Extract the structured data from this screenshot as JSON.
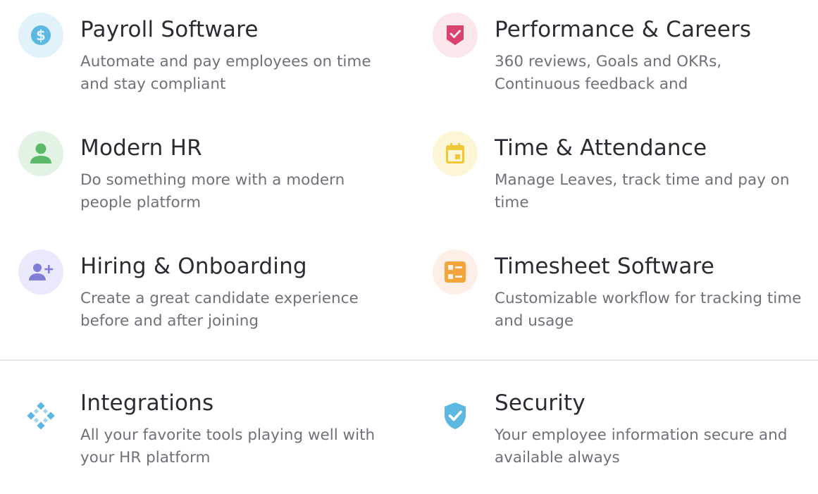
{
  "features": [
    {
      "title": "Payroll Software",
      "description": "Automate and pay employees on time and stay compliant",
      "icon": "dollar-icon",
      "icon_bg": "#e1f2fa",
      "icon_color": "#5cb8e0"
    },
    {
      "title": "Performance & Careers",
      "description": "360 reviews, Goals and OKRs, Continuous feedback and",
      "icon": "badge-check-icon",
      "icon_bg": "#fbe6ec",
      "icon_color": "#d9436d"
    },
    {
      "title": "Modern HR",
      "description": "Do something more with a modern people platform",
      "icon": "person-icon",
      "icon_bg": "#e2f2e4",
      "icon_color": "#5aba6a"
    },
    {
      "title": "Time & Attendance",
      "description": "Manage Leaves, track time and pay on time",
      "icon": "calendar-icon",
      "icon_bg": "#fdf6d6",
      "icon_color": "#f1c73a"
    },
    {
      "title": "Hiring & Onboarding",
      "description": "Create a great candidate experience before and after joining",
      "icon": "add-person-icon",
      "icon_bg": "#e9e9fb",
      "icon_color": "#7f7dd6"
    },
    {
      "title": "Timesheet Software",
      "description": "Customizable workflow for tracking time and usage",
      "icon": "timesheet-icon",
      "icon_bg": "#fdeee6",
      "icon_color": "#f3a53c"
    }
  ],
  "extras": [
    {
      "title": "Integrations",
      "description": "All your favorite tools playing well with your HR platform",
      "icon": "integrations-icon",
      "icon_color": "#5cb8e0"
    },
    {
      "title": "Security",
      "description": "Your employee information secure and available always",
      "icon": "shield-check-icon",
      "icon_color": "#5cb8e0"
    }
  ]
}
